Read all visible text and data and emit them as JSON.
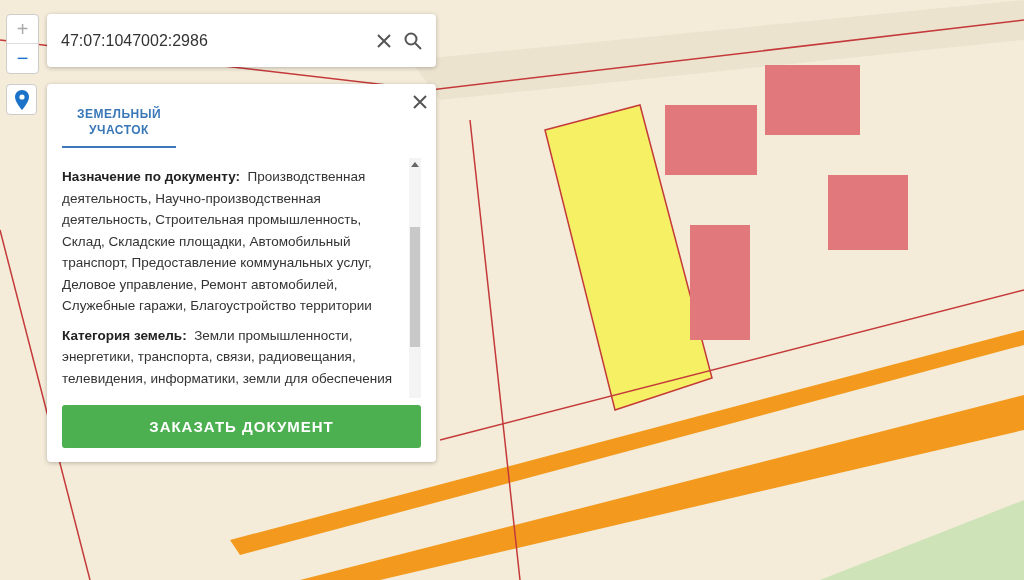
{
  "zoom": {
    "zoom_in": "+",
    "zoom_out": "−"
  },
  "search": {
    "value": "47:07:1047002:2986"
  },
  "panel": {
    "tabs": [
      {
        "label": "ЗЕМЕЛЬНЫЙ УЧАСТОК",
        "selected": true
      }
    ],
    "fields": [
      {
        "label": "Назначение по документу:",
        "value": "Производственная деятельность, Научно-производственная деятельность, Строительная промышленность, Склад, Складские площадки, Автомобильный транспорт, Предоставление коммунальных услуг, Деловое управление, Ремонт автомобилей, Служебные гаражи, Благоустройство территории"
      },
      {
        "label": "Категория земель:",
        "value": "Земли промышленности, энергетики, транспорта, связи, радиовещания, телевидения, информатики, земли для обеспечения"
      }
    ],
    "button": "ЗАКАЗАТЬ ДОКУМЕНТ"
  }
}
